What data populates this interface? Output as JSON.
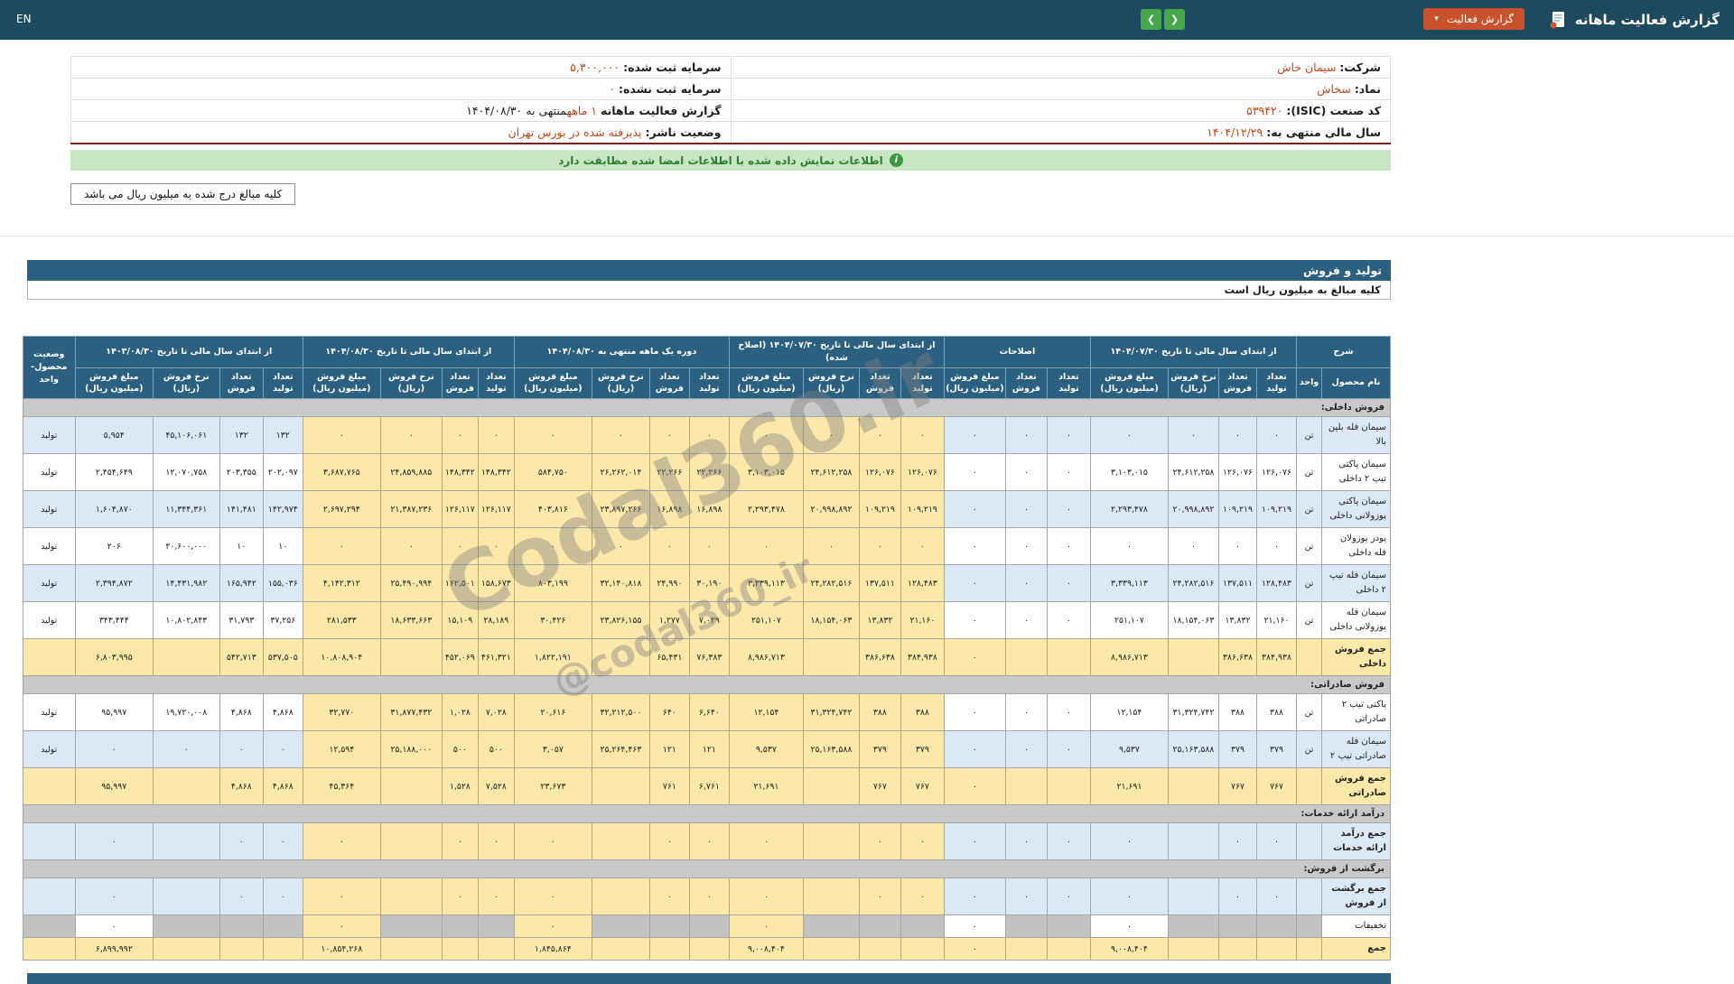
{
  "header": {
    "title": "گزارش فعالیت ماهانه",
    "report_button": "گزارش فعالیت",
    "caret_icon": "▾",
    "nav": {
      "left_arrow": "❮",
      "right_arrow": "❯"
    },
    "lang": "EN"
  },
  "company_info": {
    "rows": [
      {
        "r_label": "شرکت:",
        "r_value": "سیمان خاش",
        "l_label": "سرمایه ثبت شده:",
        "l_value": "۵,۳۰۰,۰۰۰",
        "l_suffix": ""
      },
      {
        "r_label": "نماد:",
        "r_value": "سخاش",
        "l_label": "سرمایه ثبت نشده:",
        "l_value": "۰",
        "l_suffix": ""
      },
      {
        "r_label": "کد صنعت (ISIC):",
        "r_value": "۵۳۹۴۲۰",
        "l_label": "گزارش فعالیت ماهانه",
        "l_value": "۱ ماهه",
        "l_suffix": "منتهی به ۱۴۰۴/۰۸/۳۰"
      },
      {
        "r_label": "سال مالی منتهی به:",
        "r_value": "۱۴۰۴/۱۲/۲۹",
        "l_label": "وضعیت ناشر:",
        "l_value": "پذیرفته شده در بورس تهران",
        "l_suffix": ""
      }
    ]
  },
  "notice": {
    "signed": "اطلاعات نمایش داده شده با اطلاعات امضا شده مطابقت دارد",
    "info_icon": "i",
    "amounts_box": "کلیه مبالغ درج شده به میلیون ریال می باشد"
  },
  "section": {
    "title": "تولید و فروش",
    "note": "کلیه مبالغ به میلیون ریال است"
  },
  "watermark": {
    "main": "Codal360.ir",
    "handle": "@codal360_ir"
  },
  "colors": {
    "topbar_bg": "#1d4a5e",
    "table_header_bg": "#2c6080",
    "accent_red": "#c9512b",
    "value_red": "#c4461d",
    "highlight_yellow": "#fce9a9",
    "row_blue": "#dae9f5",
    "section_gray": "#c9c9c9",
    "green_bar_bg": "#c8e6c4",
    "green": "#3a9a3f"
  },
  "table": {
    "desc_header": "شرح",
    "name_col": "نام محصول",
    "unit_col": "واحد",
    "status_col": "وضعیت محصول-واحد",
    "sub_cols": {
      "prod": "تعداد تولید",
      "sold": "تعداد فروش",
      "rate": "نرخ فروش (ریال)",
      "amount": "مبلغ فروش (میلیون ریال)"
    },
    "groups": [
      {
        "key": "g1",
        "label": "از ابتدای سال مالی تا تاریخ ۱۴۰۴/۰۷/۳۰",
        "has_rate": true,
        "highlight": false
      },
      {
        "key": "adj",
        "label": "اصلاحات",
        "has_rate": false,
        "highlight": false
      },
      {
        "key": "g2",
        "label": "از ابتدای سال مالی تا تاریخ ۱۴۰۴/۰۷/۳۰ (اصلاح شده)",
        "has_rate": true,
        "highlight": true
      },
      {
        "key": "g3",
        "label": "دوره یک ماهه منتهی به ۱۴۰۴/۰۸/۳۰",
        "has_rate": true,
        "highlight": true
      },
      {
        "key": "g4",
        "label": "از ابتدای سال مالی تا تاریخ ۱۴۰۴/۰۸/۳۰",
        "has_rate": true,
        "highlight": true
      },
      {
        "key": "g5",
        "label": "از ابتدای سال مالی تا تاریخ ۱۴۰۳/۰۸/۳۰",
        "has_rate": true,
        "highlight": false
      }
    ],
    "rows": [
      {
        "type": "section",
        "name": "فروش داخلی:"
      },
      {
        "type": "data",
        "shade": "blue",
        "name": "سیمان فله بلین بالا",
        "unit": "تن",
        "status": "تولید",
        "g1": [
          "۰",
          "۰",
          "۰",
          "۰"
        ],
        "adj": [
          "۰",
          "۰",
          "۰"
        ],
        "g2": [
          "۰",
          "۰",
          "۰",
          "۰"
        ],
        "g3": [
          "۰",
          "۰",
          "۰",
          "۰"
        ],
        "g4": [
          "۰",
          "۰",
          "۰",
          "۰"
        ],
        "g5": [
          "۱۳۲",
          "۱۳۲",
          "۴۵,۱۰۶,۰۶۱",
          "۵,۹۵۴"
        ]
      },
      {
        "type": "data",
        "shade": "white",
        "name": "سیمان پاکتی تیپ ۲ داخلی",
        "unit": "تن",
        "status": "تولید",
        "g1": [
          "۱۲۶,۰۷۶",
          "۱۲۶,۰۷۶",
          "۲۴,۶۱۲,۲۵۸",
          "۳,۱۰۳,۰۱۵"
        ],
        "adj": [
          "۰",
          "۰",
          "۰"
        ],
        "g2": [
          "۱۲۶,۰۷۶",
          "۱۲۶,۰۷۶",
          "۲۴,۶۱۲,۲۵۸",
          "۳,۱۰۳,۰۱۵"
        ],
        "g3": [
          "۲۲,۲۶۶",
          "۲۲,۲۶۶",
          "۲۶,۲۶۲,۰۱۴",
          "۵۸۴,۷۵۰"
        ],
        "g4": [
          "۱۴۸,۳۴۲",
          "۱۴۸,۳۴۲",
          "۲۴,۸۵۹,۸۸۵",
          "۳,۶۸۷,۷۶۵"
        ],
        "g5": [
          "۲۰۲,۰۹۷",
          "۲۰۳,۳۵۵",
          "۱۲,۰۷۰,۷۵۸",
          "۲,۴۵۴,۶۴۹"
        ]
      },
      {
        "type": "data",
        "shade": "blue",
        "name": "سیمان پاکتی پوزولانی داخلی",
        "unit": "تن",
        "status": "تولید",
        "g1": [
          "۱۰۹,۲۱۹",
          "۱۰۹,۲۱۹",
          "۲۰,۹۹۸,۸۹۲",
          "۲,۲۹۳,۴۷۸"
        ],
        "adj": [
          "۰",
          "۰",
          "۰"
        ],
        "g2": [
          "۱۰۹,۲۱۹",
          "۱۰۹,۲۱۹",
          "۲۰,۹۹۸,۸۹۲",
          "۲,۲۹۳,۴۷۸"
        ],
        "g3": [
          "۱۶,۸۹۸",
          "۱۶,۸۹۸",
          "۲۳,۸۹۷,۲۶۶",
          "۴۰۳,۸۱۶"
        ],
        "g4": [
          "۱۲۶,۱۱۷",
          "۱۲۶,۱۱۷",
          "۲۱,۳۸۷,۲۳۶",
          "۲,۶۹۷,۲۹۴"
        ],
        "g5": [
          "۱۴۲,۹۷۴",
          "۱۴۱,۴۸۱",
          "۱۱,۳۴۴,۳۶۱",
          "۱,۶۰۴,۸۷۰"
        ]
      },
      {
        "type": "data",
        "shade": "white",
        "name": "پودر پوزولان فله داخلی",
        "unit": "تن",
        "status": "تولید",
        "g1": [
          "۰",
          "۰",
          "۰",
          "۰"
        ],
        "adj": [
          "۰",
          "۰",
          "۰"
        ],
        "g2": [
          "۰",
          "۰",
          "۰",
          "۰"
        ],
        "g3": [
          "۰",
          "۰",
          "۰",
          "۰"
        ],
        "g4": [
          "۰",
          "۰",
          "۰",
          "۰"
        ],
        "g5": [
          "۱۰",
          "۱۰",
          "۲۰,۶۰۰,۰۰۰",
          "۲۰۶"
        ]
      },
      {
        "type": "data",
        "shade": "blue",
        "name": "سیمان فله تیپ ۲ داخلی",
        "unit": "تن",
        "status": "تولید",
        "g1": [
          "۱۲۸,۴۸۳",
          "۱۳۷,۵۱۱",
          "۲۴,۲۸۲,۵۱۶",
          "۳,۳۳۹,۱۱۳"
        ],
        "adj": [
          "۰",
          "۰",
          "۰"
        ],
        "g2": [
          "۱۲۸,۴۸۳",
          "۱۳۷,۵۱۱",
          "۲۴,۲۸۲,۵۱۶",
          "۳,۳۳۹,۱۱۳"
        ],
        "g3": [
          "۳۰,۱۹۰",
          "۲۴,۹۹۰",
          "۳۲,۱۴۰,۸۱۸",
          "۸۰۳,۱۹۹"
        ],
        "g4": [
          "۱۵۸,۶۷۳",
          "۱۶۲,۵۰۱",
          "۲۵,۴۹۰,۹۹۴",
          "۴,۱۴۲,۳۱۲"
        ],
        "g5": [
          "۱۵۵,۰۳۶",
          "۱۶۵,۹۴۲",
          "۱۴,۴۳۱,۹۸۲",
          "۲,۳۹۴,۸۷۲"
        ]
      },
      {
        "type": "data",
        "shade": "white",
        "name": "سیمان فله پوزولانی داخلی",
        "unit": "تن",
        "status": "تولید",
        "g1": [
          "۲۱,۱۶۰",
          "۱۳,۸۳۲",
          "۱۸,۱۵۴,۰۶۳",
          "۲۵۱,۱۰۷"
        ],
        "adj": [
          "۰",
          "۰",
          "۰"
        ],
        "g2": [
          "۲۱,۱۶۰",
          "۱۳,۸۳۲",
          "۱۸,۱۵۴,۰۶۳",
          "۲۵۱,۱۰۷"
        ],
        "g3": [
          "۷,۰۲۹",
          "۱,۲۷۷",
          "۲۳,۸۲۶,۱۵۵",
          "۳۰,۴۲۶"
        ],
        "g4": [
          "۲۸,۱۸۹",
          "۱۵,۱۰۹",
          "۱۸,۶۳۳,۶۶۳",
          "۲۸۱,۵۳۳"
        ],
        "g5": [
          "۳۷,۲۵۶",
          "۳۱,۷۹۳",
          "۱۰,۸۰۲,۸۴۳",
          "۳۴۳,۴۴۴"
        ]
      },
      {
        "type": "total",
        "name": "جمع فروش داخلی",
        "g1": [
          "۳۸۴,۹۳۸",
          "۳۸۶,۶۳۸",
          "",
          "۸,۹۸۶,۷۱۳"
        ],
        "adj": [
          "",
          "",
          "۰"
        ],
        "g2": [
          "۳۸۴,۹۳۸",
          "۳۸۶,۶۳۸",
          "",
          "۸,۹۸۶,۷۱۳"
        ],
        "g3": [
          "۷۶,۳۸۳",
          "۶۵,۴۳۱",
          "",
          "۱,۸۲۲,۱۹۱"
        ],
        "g4": [
          "۴۶۱,۳۲۱",
          "۴۵۲,۰۶۹",
          "",
          "۱۰,۸۰۸,۹۰۴"
        ],
        "g5": [
          "۵۳۷,۵۰۵",
          "۵۴۲,۷۱۳",
          "",
          "۶,۸۰۳,۹۹۵"
        ]
      },
      {
        "type": "section",
        "name": "فروش صادراتی:"
      },
      {
        "type": "data",
        "shade": "white",
        "name": "پاکتی تیپ ۲ صادراتی",
        "unit": "تن",
        "status": "تولید",
        "g1": [
          "۳۸۸",
          "۳۸۸",
          "۳۱,۳۲۴,۷۴۲",
          "۱۲,۱۵۴"
        ],
        "adj": [
          "۰",
          "۰",
          "۰"
        ],
        "g2": [
          "۳۸۸",
          "۳۸۸",
          "۳۱,۳۲۴,۷۴۲",
          "۱۲,۱۵۴"
        ],
        "g3": [
          "۶,۶۴۰",
          "۶۴۰",
          "۳۲,۲۱۲,۵۰۰",
          "۲۰,۶۱۶"
        ],
        "g4": [
          "۷,۰۲۸",
          "۱,۰۲۸",
          "۳۱,۸۷۷,۴۳۲",
          "۳۲,۷۷۰"
        ],
        "g5": [
          "۴,۸۶۸",
          "۴,۸۶۸",
          "۱۹,۷۲۰,۰۰۸",
          "۹۵,۹۹۷"
        ]
      },
      {
        "type": "data",
        "shade": "blue",
        "name": "سیمان فله صادراتی تیپ ۲",
        "unit": "تن",
        "status": "تولید",
        "g1": [
          "۳۷۹",
          "۳۷۹",
          "۲۵,۱۶۳,۵۸۸",
          "۹,۵۳۷"
        ],
        "adj": [
          "۰",
          "۰",
          "۰"
        ],
        "g2": [
          "۳۷۹",
          "۳۷۹",
          "۲۵,۱۶۳,۵۸۸",
          "۹,۵۳۷"
        ],
        "g3": [
          "۱۲۱",
          "۱۲۱",
          "۲۵,۲۶۴,۴۶۳",
          "۳,۰۵۷"
        ],
        "g4": [
          "۵۰۰",
          "۵۰۰",
          "۲۵,۱۸۸,۰۰۰",
          "۱۲,۵۹۴"
        ],
        "g5": [
          "۰",
          "۰",
          "۰",
          "۰"
        ]
      },
      {
        "type": "total",
        "name": "جمع فروش صادراتی",
        "g1": [
          "۷۶۷",
          "۷۶۷",
          "",
          "۲۱,۶۹۱"
        ],
        "adj": [
          "",
          "",
          "۰"
        ],
        "g2": [
          "۷۶۷",
          "۷۶۷",
          "",
          "۲۱,۶۹۱"
        ],
        "g3": [
          "۶,۷۶۱",
          "۷۶۱",
          "",
          "۲۳,۶۷۳"
        ],
        "g4": [
          "۷,۵۲۸",
          "۱,۵۲۸",
          "",
          "۴۵,۳۶۴"
        ],
        "g5": [
          "۴,۸۶۸",
          "۴,۸۶۸",
          "",
          "۹۵,۹۹۷"
        ]
      },
      {
        "type": "section",
        "name": "درآمد ارائه خدمات:"
      },
      {
        "type": "data",
        "shade": "blue",
        "bold": true,
        "name": "جمع درآمد ارائه خدمات",
        "unit": "",
        "status": "",
        "g1": [
          "۰",
          "۰",
          "",
          "۰"
        ],
        "adj": [
          "۰",
          "۰",
          "۰"
        ],
        "g2": [
          "۰",
          "۰",
          "",
          "۰"
        ],
        "g3": [
          "۰",
          "۰",
          "",
          "۰"
        ],
        "g4": [
          "۰",
          "۰",
          "",
          "۰"
        ],
        "g5": [
          "۰",
          "۰",
          "",
          "۰"
        ]
      },
      {
        "type": "section",
        "name": "برگشت از فروش:"
      },
      {
        "type": "data",
        "shade": "blue",
        "bold": true,
        "name": "جمع برگشت از فروش",
        "unit": "",
        "status": "",
        "g1": [
          "۰",
          "۰",
          "",
          "۰"
        ],
        "adj": [
          "۰",
          "۰",
          "۰"
        ],
        "g2": [
          "۰",
          "۰",
          "",
          "۰"
        ],
        "g3": [
          "۰",
          "۰",
          "",
          "۰"
        ],
        "g4": [
          "۰",
          "۰",
          "",
          "۰"
        ],
        "g5": [
          "۰",
          "۰",
          "",
          "۰"
        ]
      },
      {
        "type": "data",
        "shade": "white",
        "dim": true,
        "name": "تخفیفات",
        "unit": "",
        "status": "",
        "g1": [
          "",
          "",
          "",
          "۰"
        ],
        "adj": [
          "",
          "",
          "۰"
        ],
        "g2": [
          "",
          "",
          "",
          "۰"
        ],
        "g3": [
          "",
          "",
          "",
          "۰"
        ],
        "g4": [
          "",
          "",
          "",
          "۰"
        ],
        "g5": [
          "",
          "",
          "",
          "۰"
        ]
      },
      {
        "type": "total",
        "name": "جمع",
        "g1": [
          "",
          "",
          "",
          "۹,۰۰۸,۴۰۴"
        ],
        "adj": [
          "",
          "",
          "۰"
        ],
        "g2": [
          "",
          "",
          "",
          "۹,۰۰۸,۴۰۴"
        ],
        "g3": [
          "",
          "",
          "",
          "۱,۸۴۵,۸۶۴"
        ],
        "g4": [
          "",
          "",
          "",
          "۱۰,۸۵۴,۲۶۸"
        ],
        "g5": [
          "",
          "",
          "",
          "۶,۸۹۹,۹۹۲"
        ]
      }
    ]
  }
}
